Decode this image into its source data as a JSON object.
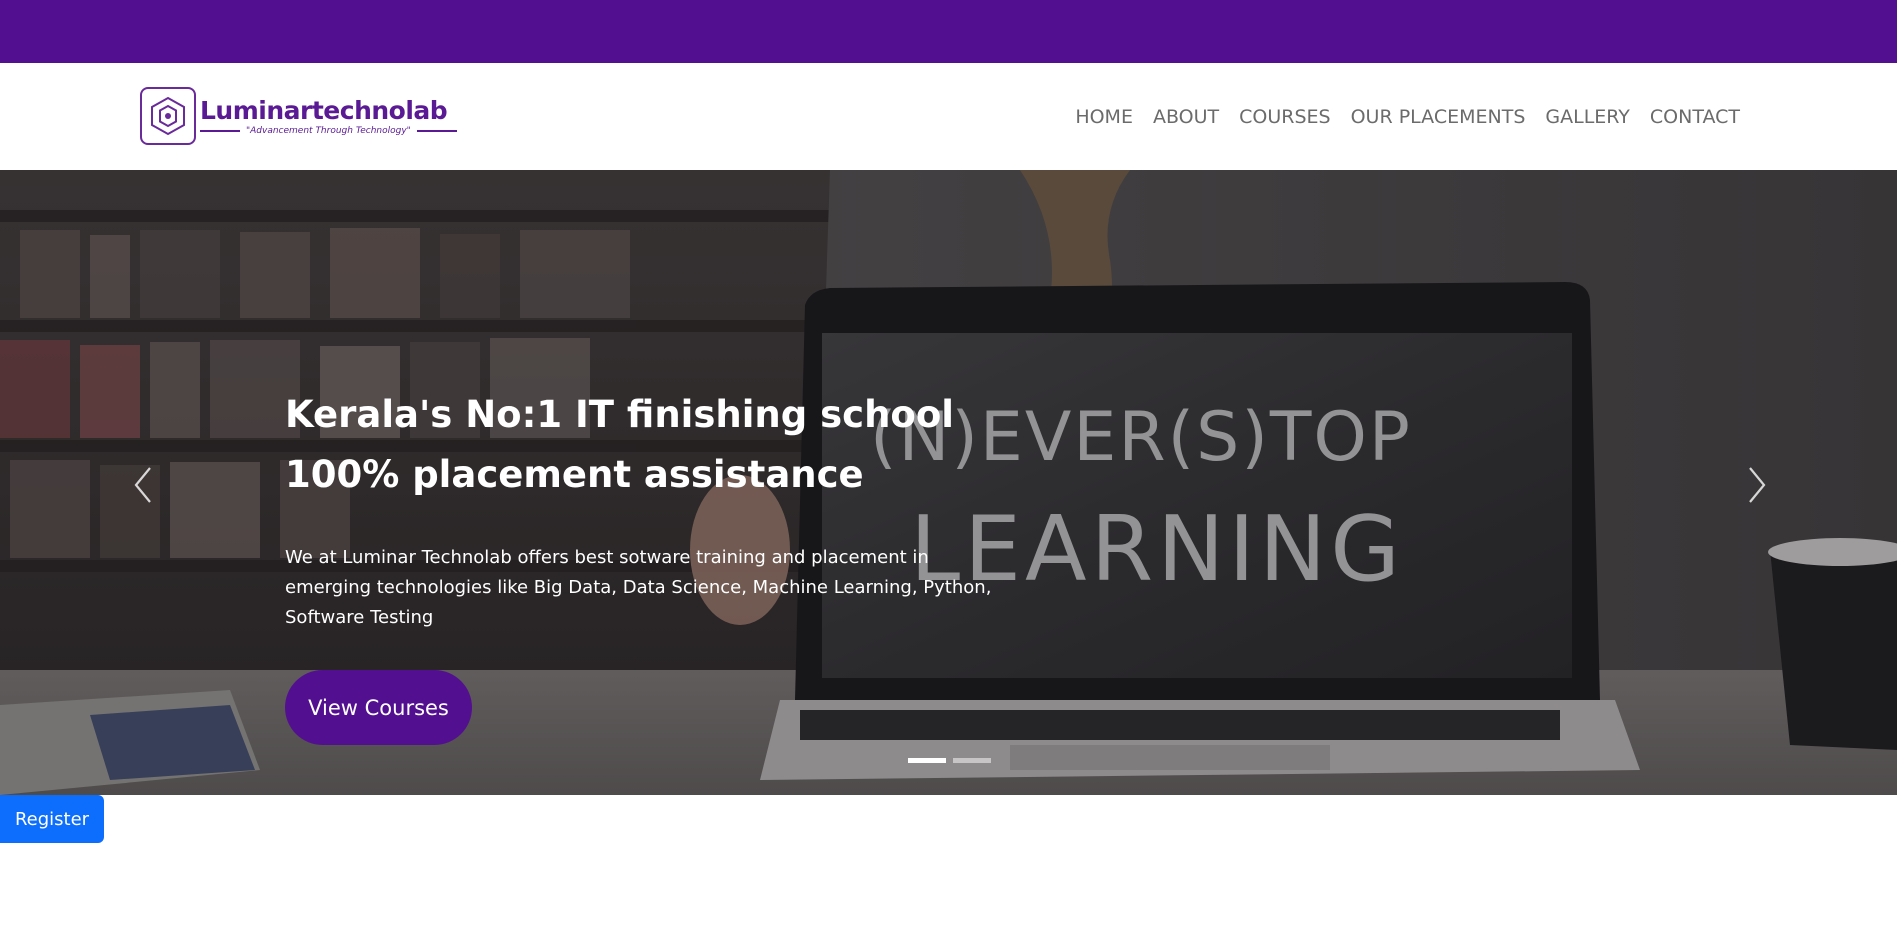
{
  "brand": {
    "name": "Luminartechnolab",
    "tagline": "\"Advancement Through Technology\"",
    "icon": "hexagon-logo-icon",
    "color": "#521090"
  },
  "nav": {
    "items": [
      {
        "label": "HOME"
      },
      {
        "label": "ABOUT"
      },
      {
        "label": "COURSES"
      },
      {
        "label": "OUR PLACEMENTS"
      },
      {
        "label": "GALLERY"
      },
      {
        "label": "CONTACT"
      }
    ]
  },
  "hero": {
    "headline_line1": "Kerala's No:1 IT finishing school",
    "headline_line2": "100% placement assistance",
    "description": "We at Luminar Technolab offers best sotware training and placement in emerging technologies like Big Data, Data Science, Machine Learning, Python, Software Testing",
    "cta_label": "View Courses",
    "chalkboard_line1": "(N)EVER(S)TOP",
    "chalkboard_line2": "LEARNING",
    "prev_icon": "chevron-left-icon",
    "next_icon": "chevron-right-icon",
    "slide_count": 2,
    "active_slide": 1
  },
  "register": {
    "label": "Register",
    "color": "#0d6efd"
  },
  "colors": {
    "topbar": "#521090",
    "cta": "#521090",
    "nav_text": "#6b6b6b"
  }
}
